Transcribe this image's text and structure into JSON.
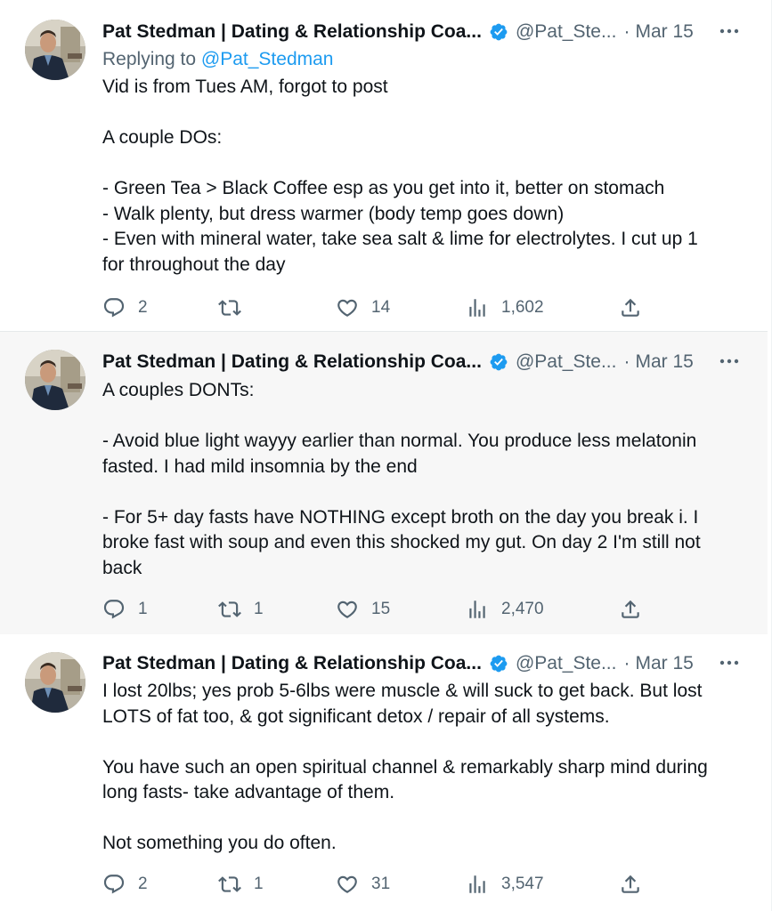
{
  "tweets": [
    {
      "author_name": "Pat Stedman | Dating & Relationship Coa...",
      "handle": "@Pat_Ste...",
      "dot": "·",
      "date": "Mar 15",
      "replying_to_prefix": "Replying to ",
      "replying_to_handle": "@Pat_Stedman",
      "paragraphs": [
        [
          "Vid is from Tues AM, forgot to post"
        ],
        [
          "A couple DOs:"
        ],
        [
          "- Green Tea > Black Coffee esp as you get into it, better on stomach",
          "- Walk plenty, but dress warmer (body temp goes down)",
          "- Even with mineral water, take sea salt & lime for electrolytes. I cut up 1",
          "for throughout the day"
        ]
      ],
      "replies": "2",
      "retweets": "",
      "likes": "14",
      "views": "1,602"
    },
    {
      "author_name": "Pat Stedman | Dating & Relationship Coa...",
      "handle": "@Pat_Ste...",
      "dot": "·",
      "date": "Mar 15",
      "paragraphs": [
        [
          "A couples DONTs:"
        ],
        [
          "- Avoid blue light wayyy earlier than normal. You produce less melatonin",
          "fasted. I had mild insomnia by the end"
        ],
        [
          "- For 5+ day fasts have NOTHING except broth on the day you break i. I",
          "broke fast with soup and even this shocked my gut. On day 2 I'm still not",
          "back"
        ]
      ],
      "replies": "1",
      "retweets": "1",
      "likes": "15",
      "views": "2,470"
    },
    {
      "author_name": "Pat Stedman | Dating & Relationship Coa...",
      "handle": "@Pat_Ste...",
      "dot": "·",
      "date": "Mar 15",
      "paragraphs": [
        [
          "I lost 20lbs; yes prob 5-6lbs were muscle & will suck to get back. But lost",
          "LOTS of fat too, & got significant detox / repair of all systems."
        ],
        [
          "You have such an open spiritual channel & remarkably sharp mind during",
          "long fasts- take advantage of them."
        ],
        [
          "Not something you do often."
        ]
      ],
      "replies": "2",
      "retweets": "1",
      "likes": "31",
      "views": "3,547"
    }
  ],
  "icons": {
    "verified": "verified-badge-icon",
    "more": "more-horizontal-icon",
    "reply": "reply-bubble-icon",
    "retweet": "retweet-icon",
    "like": "heart-icon",
    "views": "views-bar-chart-icon",
    "share": "share-upload-icon"
  },
  "colors": {
    "verified": "#1d9bf0",
    "mention": "#1d9bf0",
    "secondary_text": "#536471",
    "highlight_bg": "#f7f7f7"
  }
}
